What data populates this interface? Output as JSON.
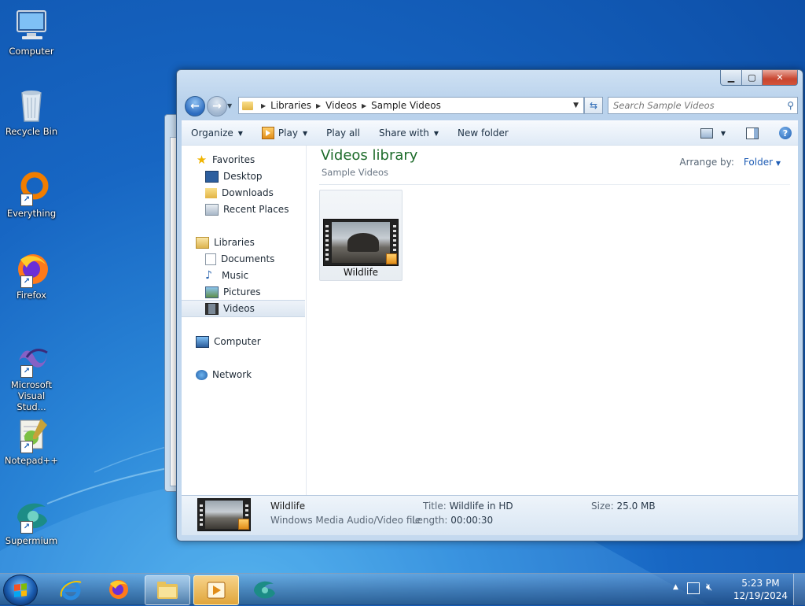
{
  "desktop": {
    "icons": [
      {
        "label": "Computer"
      },
      {
        "label": "Recycle Bin"
      },
      {
        "label": "Everything"
      },
      {
        "label": "Firefox"
      },
      {
        "label": "Microsoft Visual Stud..."
      },
      {
        "label": "Notepad++"
      },
      {
        "label": "Supermium"
      }
    ]
  },
  "window": {
    "caption": {
      "minimize": "▁",
      "maximize": "▢",
      "close": "✕"
    },
    "address": {
      "crumbs": [
        "Libraries",
        "Videos",
        "Sample Videos"
      ]
    },
    "search": {
      "placeholder": "Search Sample Videos"
    },
    "toolbar": {
      "organize": "Organize",
      "play": "Play",
      "play_all": "Play all",
      "share_with": "Share with",
      "new_folder": "New folder"
    },
    "nav": {
      "favorites": "Favorites",
      "desktop": "Desktop",
      "downloads": "Downloads",
      "recent_places": "Recent Places",
      "libraries": "Libraries",
      "documents": "Documents",
      "music": "Music",
      "pictures": "Pictures",
      "videos": "Videos",
      "computer": "Computer",
      "network": "Network"
    },
    "content": {
      "title": "Videos library",
      "subtitle": "Sample Videos",
      "arrange_label": "Arrange by:",
      "arrange_value": "Folder",
      "files": [
        {
          "name": "Wildlife"
        }
      ]
    },
    "details": {
      "name": "Wildlife",
      "type": "Windows Media Audio/Video file",
      "title_label": "Title:",
      "title_value": "Wildlife in HD",
      "length_label": "Length:",
      "length_value": "00:00:30",
      "size_label": "Size:",
      "size_value": "25.0 MB"
    }
  },
  "taskbar": {
    "clock": {
      "time": "5:23 PM",
      "date": "12/19/2024"
    }
  },
  "colors": {
    "accent": "#1d6b2a",
    "link": "#1f5db5",
    "desktop": "#1766c3"
  }
}
